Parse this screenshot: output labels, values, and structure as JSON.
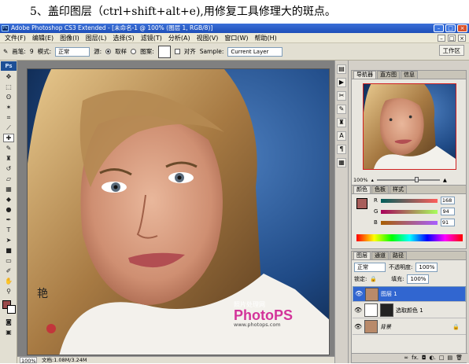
{
  "caption": "5、盖印图层（ctrl+shift+alt+e),用修复工具修理大的斑点。",
  "window": {
    "title": "Adobe Photoshop CS3 Extended - [未命名-1 @ 100% (图层 1, RGB/8)]",
    "app_icon": "Ps",
    "min": "–",
    "max": "□",
    "close": "×"
  },
  "menu": [
    "文件(F)",
    "编辑(E)",
    "图像(I)",
    "图层(L)",
    "选择(S)",
    "滤镜(T)",
    "分析(A)",
    "视图(V)",
    "窗口(W)",
    "帮助(H)"
  ],
  "options": {
    "brush_label": "画笔:",
    "brush_size": "9",
    "mode_label": "模式:",
    "mode_value": "正常",
    "source_label": "源:",
    "sample_radio": "取样",
    "pattern_radio": "图案:",
    "aligned_label": "对齐",
    "sample_label": "Sample:",
    "sample_value": "Current Layer",
    "workspace": "工作区"
  },
  "toolbox": {
    "logo": "Ps",
    "fg_color": "#9a4a4a",
    "bg_color": "#ffffff"
  },
  "status": {
    "zoom": "100%",
    "doc": "文档:1.08M/3.24M"
  },
  "watermark": {
    "site": "照片处理网",
    "brand": "PhotoPS",
    "url": "www.photops.com"
  },
  "navigator": {
    "tabs": [
      "导航器",
      "直方图",
      "信息"
    ],
    "zoom": "100%"
  },
  "color": {
    "tabs": [
      "颜色",
      "色板",
      "样式"
    ],
    "r_label": "R",
    "g_label": "G",
    "b_label": "B",
    "r": "168",
    "g": "94",
    "b": "91",
    "swatch": "#a85e5b"
  },
  "layers": {
    "tabs": [
      "图层",
      "通道",
      "路径"
    ],
    "blend": "正常",
    "opacity_label": "不透明度:",
    "opacity": "100%",
    "lock_label": "锁定:",
    "fill_label": "填充:",
    "fill": "100%",
    "items": [
      {
        "name": "图层 1"
      },
      {
        "name": "选取颜色 1"
      },
      {
        "name": "背景"
      }
    ],
    "footer": [
      "∞",
      "fx.",
      "◘",
      "◐.",
      "□",
      "▤",
      "🗑"
    ]
  }
}
